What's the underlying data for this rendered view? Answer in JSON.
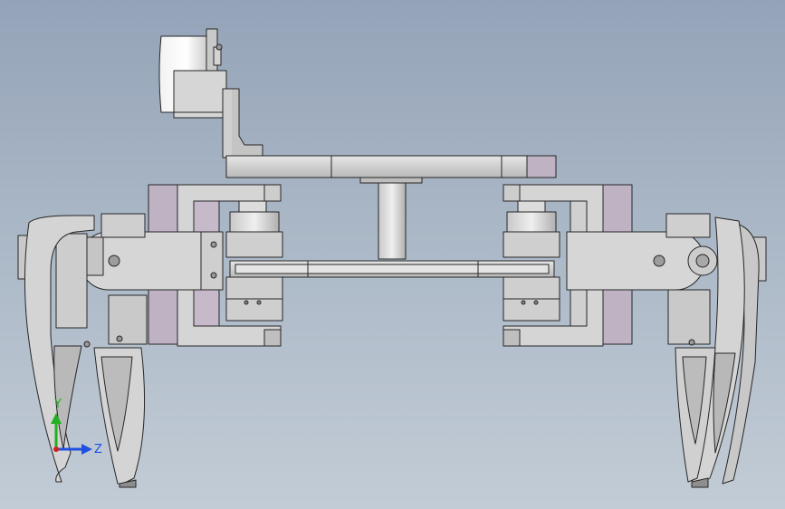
{
  "viewport": {
    "background_top": "#94a3b8",
    "background_bottom": "#c2ccd6"
  },
  "model": {
    "part_fill": "#d9d9d9",
    "part_shade": "#bdbdbd",
    "part_dark": "#9e9e9e",
    "edge_color": "#262626",
    "purple_tint": "#bfb2c2"
  },
  "triad": {
    "y_label": "Y",
    "z_label": "Z",
    "y_color": "#20b020",
    "z_color": "#2050e0",
    "x_color": "#d02020"
  }
}
